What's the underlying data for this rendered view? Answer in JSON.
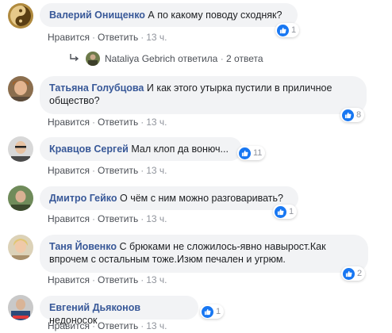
{
  "actions": {
    "like": "Нравится",
    "reply": "Ответить",
    "sep": "·"
  },
  "comments": [
    {
      "author": "Валерий Онищенко",
      "text": "А по какому поводу сходняк?",
      "time": "13 ч.",
      "likes": "1"
    },
    {
      "author": "Татьяна Голубцова",
      "text": "И как этого утырка пустили в приличное общество?",
      "time": "13 ч.",
      "likes": "8"
    },
    {
      "author": "Кравцов Сергей",
      "text": "Мал клоп да вонюч...",
      "time": "13 ч.",
      "likes": "11"
    },
    {
      "author": "Дмитро Гейко",
      "text": "О чём с ним можно разговаривать?",
      "time": "13 ч.",
      "likes": "1"
    },
    {
      "author": "Таня Йовенко",
      "text": "С брюками не сложилось-явно навырост.Как впрочем с остальным тоже.Изюм печален и угрюм.",
      "time": "13 ч.",
      "likes": "2"
    },
    {
      "author": "Евгений Дьяконов",
      "text": "недоносок",
      "time": "13 ч.",
      "likes": "1"
    }
  ],
  "replies_summary": {
    "author": "Nataliya Gebrich",
    "verb": "ответила",
    "sep": "·",
    "count_text": "2 ответа"
  },
  "colors": {
    "link": "#385898",
    "bubble": "#f2f3f5",
    "like": "#1877f2",
    "meta": "#90949c"
  },
  "icons": {
    "reply_arrow": "reply-arrow-icon",
    "like": "like-thumb-icon"
  }
}
